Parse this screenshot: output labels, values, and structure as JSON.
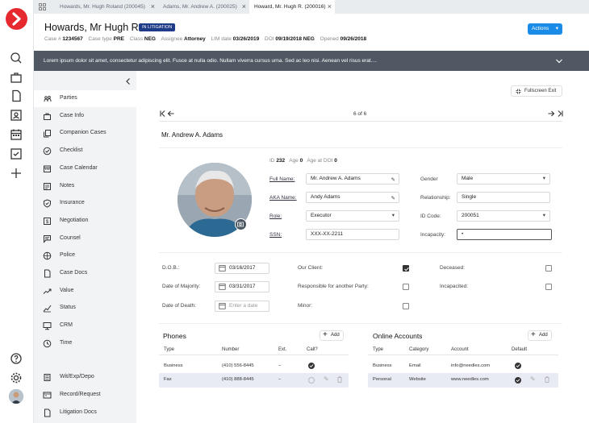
{
  "tabs": [
    {
      "label": "Howards, Mr. Hugh Roland (200045)"
    },
    {
      "label": "Adams, Mr. Andrew A. (200025)"
    },
    {
      "label": "Howard, Mr. Hugh R. (200016)"
    }
  ],
  "header": {
    "title": "Howards, Mr Hugh R.",
    "badge": "IN LITIGATION",
    "meta": [
      {
        "label": "Case #",
        "value": "1234567"
      },
      {
        "label": "Case type",
        "value": "PRE"
      },
      {
        "label": "Class",
        "value": "NEG"
      },
      {
        "label": "Assignee",
        "value": "Attorney"
      },
      {
        "label": "LIM date",
        "value": "03/26/2019"
      },
      {
        "label": "DOI",
        "value": "09/19/2018 NEG"
      },
      {
        "label": "Opened",
        "value": "09/26/2018"
      }
    ],
    "actions_label": "Actions"
  },
  "banner": {
    "text": "Lorem ipsum dolor sit amet, consectetur adipiscing elit. Fusce at nulla odio. Nullam viverra cursus urna. Sed ac leo nisi. Aenean vel risus erat...."
  },
  "sidebar": {
    "items": [
      {
        "label": "Parties",
        "icon": "people-icon"
      },
      {
        "label": "Case Info",
        "icon": "briefcase-icon"
      },
      {
        "label": "Companion Cases",
        "icon": "copy-icon"
      },
      {
        "label": "Checklist",
        "icon": "check-circle-icon"
      },
      {
        "label": "Case Calendar",
        "icon": "calendar-icon"
      },
      {
        "label": "Notes",
        "icon": "notes-icon"
      },
      {
        "label": "Insurance",
        "icon": "shield-check-icon"
      },
      {
        "label": "Negotiation",
        "icon": "dollar-icon"
      },
      {
        "label": "Counsel",
        "icon": "chat-icon"
      },
      {
        "label": "Police",
        "icon": "badge-icon"
      },
      {
        "label": "Case Docs",
        "icon": "document-icon"
      },
      {
        "label": "Value",
        "icon": "trend-icon"
      },
      {
        "label": "Status",
        "icon": "status-icon"
      },
      {
        "label": "CRM",
        "icon": "monitor-icon"
      },
      {
        "label": "Time",
        "icon": "clock-icon"
      }
    ],
    "items2": [
      {
        "label": "Wit/Exp/Depo",
        "icon": "stack-icon"
      },
      {
        "label": "Record/Request",
        "icon": "record-icon"
      },
      {
        "label": "Litigation Docs",
        "icon": "document-icon"
      }
    ]
  },
  "main": {
    "fullscreen_label": "Fullscreen Exit",
    "pager": "6 of 6",
    "party_name": "Mr. Andrew A. Adams",
    "id_row": [
      {
        "label": "ID",
        "value": "232"
      },
      {
        "label": "Age",
        "value": "0"
      },
      {
        "label": "Age at DOI",
        "value": "0"
      }
    ],
    "fields_left": [
      {
        "label": "Full Name:",
        "value": "Mr. Andrew A. Adams"
      },
      {
        "label": "AKA Name:",
        "value": "Andy Adams"
      },
      {
        "label": "Role:",
        "value": "Executor"
      },
      {
        "label": "SSN:",
        "value": "XXX-XX-2211"
      }
    ],
    "fields_right": [
      {
        "label": "Gender",
        "value": "Male"
      },
      {
        "label": "Relationship:",
        "value": "Single"
      },
      {
        "label": "ID Code:",
        "value": "200051"
      },
      {
        "label": "Incapacity:",
        "value": ""
      }
    ],
    "dates": [
      {
        "label": "D.O.B.:",
        "value": "03/16/2017",
        "placeholder": ""
      },
      {
        "label": "Date of Majority:",
        "value": "03/31/2017",
        "placeholder": ""
      },
      {
        "label": "Date of Death:",
        "value": "",
        "placeholder": "Enter a date"
      }
    ],
    "flags_mid": [
      {
        "label": "Our Client:",
        "checked": true
      },
      {
        "label": "Responsible for another Party:",
        "checked": false
      },
      {
        "label": "Minor:",
        "checked": false
      }
    ],
    "flags_right": [
      {
        "label": "Deceased:",
        "checked": false
      },
      {
        "label": "Incapacited:",
        "checked": false
      }
    ],
    "phones": {
      "title": "Phones",
      "add_label": "Add",
      "headers": [
        "Type",
        "Number",
        "Ext.",
        "Call?"
      ],
      "rows": [
        {
          "type": "Business",
          "number": "(410) 556-8445",
          "ext": "–"
        },
        {
          "type": "Fax",
          "number": "(410) 888-8445",
          "ext": "–"
        }
      ]
    },
    "accounts": {
      "title": "Online Accounts",
      "add_label": "Add",
      "headers": [
        "Type",
        "Category",
        "Account",
        "Default"
      ],
      "rows": [
        {
          "type": "Business",
          "category": "Email",
          "account": "info@needles.com"
        },
        {
          "type": "Personal",
          "category": "Website",
          "account": "www.needles.com"
        }
      ]
    }
  }
}
